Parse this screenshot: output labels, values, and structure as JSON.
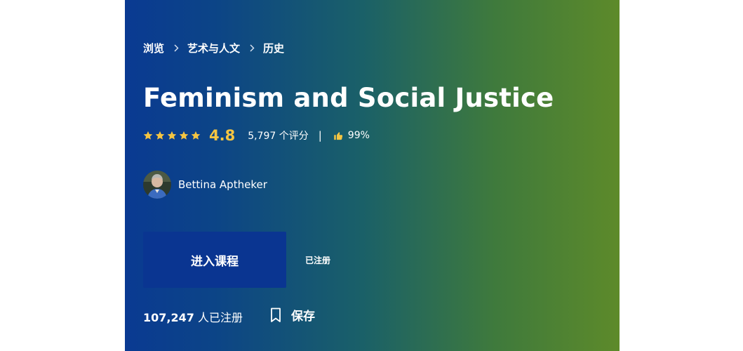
{
  "breadcrumb": {
    "items": [
      "浏览",
      "艺术与人文",
      "历史"
    ]
  },
  "course": {
    "title": "Feminism and Social Justice",
    "rating": {
      "stars": 5,
      "value": "4.8",
      "count_text": "5,797 个评分",
      "divider": "|",
      "approval_percent": "99%"
    },
    "instructor": {
      "name": "Bettina Aptheker"
    },
    "enter_button_label": "进入课程",
    "enrolled_status": "已注册",
    "enrollment": {
      "count": "107,247",
      "suffix": "人已注册"
    },
    "save_label": "保存"
  },
  "colors": {
    "gradient_start": "#0a3a92",
    "gradient_end": "#5d8a2a",
    "button_bg": "#0a3591",
    "star_color": "#f5c542"
  },
  "icons": {
    "breadcrumb_separator": "chevron-right-icon",
    "star": "star-icon",
    "thumbs_up": "thumbs-up-icon",
    "bookmark": "bookmark-icon"
  }
}
